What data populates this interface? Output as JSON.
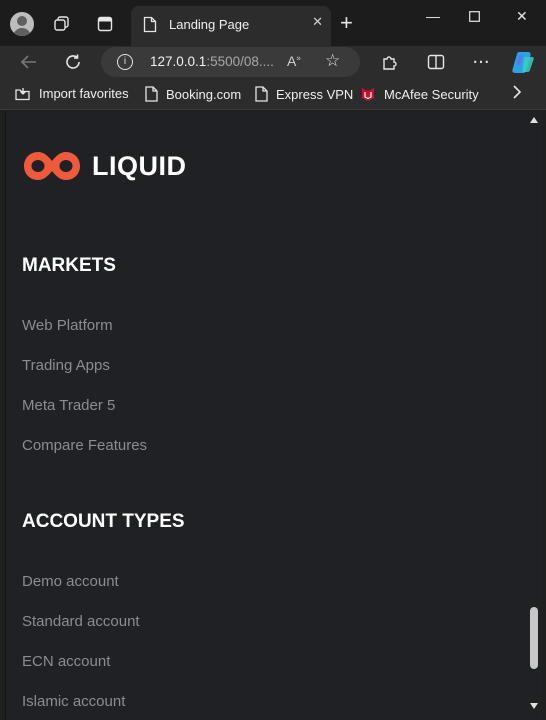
{
  "browser": {
    "tab": {
      "title": "Landing Page"
    },
    "address": {
      "host": "127.0.0.1",
      "rest": ":5500/08...."
    },
    "bookmarks": [
      {
        "label": "Import favorites",
        "icon": "import-icon"
      },
      {
        "label": "Booking.com",
        "icon": "page-icon"
      },
      {
        "label": "Express VPN",
        "icon": "page-icon"
      },
      {
        "label": "McAfee Security",
        "icon": "mcafee-icon"
      }
    ]
  },
  "page": {
    "logo": {
      "text": "LIQUID",
      "color": "#ef5a3c"
    },
    "markets": {
      "title": "MARKETS",
      "links": [
        "Web Platform",
        "Trading Apps",
        "Meta Trader 5",
        "Compare Features"
      ]
    },
    "account_types": {
      "title": "ACCOUNT TYPES",
      "links": [
        "Demo account",
        "Standard account",
        "ECN account",
        "Islamic account"
      ]
    }
  },
  "colors": {
    "page_bg": "#202124",
    "link": "#8b8d93",
    "heading": "#ffffff",
    "accent": "#ef5a3c"
  }
}
